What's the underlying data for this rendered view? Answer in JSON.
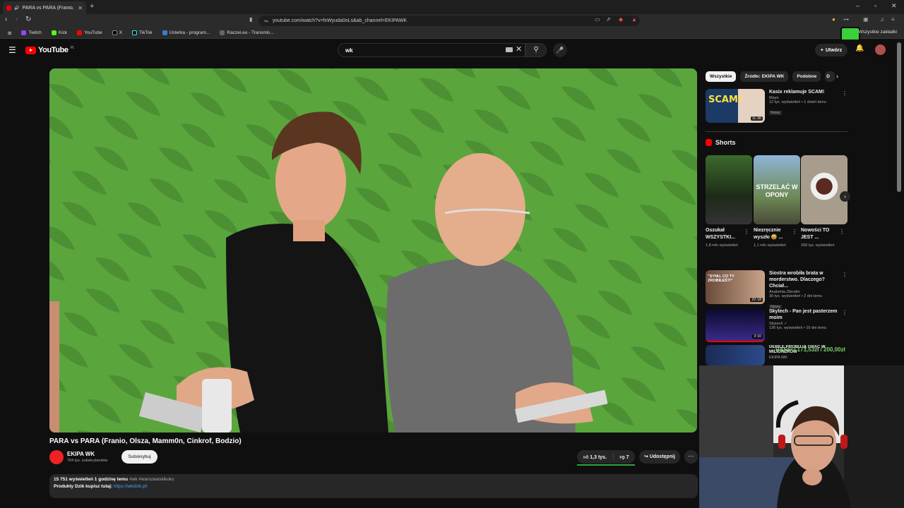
{
  "browser": {
    "tab_title": "PARA vs PARA (Franio, Olsza,",
    "url": "youtube.com/watch?v=fxWyuda0oLs&ab_channel=EKIPAWK",
    "bookmarks": [
      "Twitch",
      "Kick",
      "YouTube",
      "X",
      "TikTok",
      "Usterka - program...",
      "Raczei.eu - Transmis..."
    ],
    "all_bookmarks": "Wszystkie zakładki"
  },
  "youtube": {
    "logo": "YouTube",
    "region": "PL",
    "search_value": "wk",
    "create_label": "Utwórz"
  },
  "video": {
    "title": "PARA vs PARA (Franio, Olsza, Mamm0n, Cinkrof, Bodzio)",
    "channel": "EKIPA WK",
    "subscribers": "704 tys. subskrybentów",
    "subscribe_label": "Subskrybuj",
    "likes": "1,3 tys.",
    "dislikes": "7",
    "share_label": "Udostępnij",
    "views_time": "15 751 wyświetleń  1 godzinę temu",
    "tags": "#wk #warszawskikoks",
    "products_text": "Produkty Dzik kupisz tutaj:",
    "products_link": "https://wkdzik.pl/"
  },
  "sidebar": {
    "chips": [
      "Wszystkie",
      "Źródło: EKIPA WK",
      "Podobne",
      "D"
    ],
    "recs": [
      {
        "title": "Kasix reklamuje SCAM!",
        "channel": "Mayo",
        "meta": "12 tys. wyświetleń • 1 dzień temu",
        "badge": "Nowy",
        "duration": "11:30",
        "thumb": "SCAM!"
      },
      {
        "title": "Siostra wrobiła brata w morderstwo. Dlaczego? Chciał...",
        "channel": "Anatomia Zbrodni",
        "meta": "30 tys. wyświetleń • 2 dni temu",
        "badge": "Nowy",
        "duration": "22:18",
        "thumb": "\"SYNU, CO TY ZROBIŁEŚ?!\""
      },
      {
        "title": "Skytech - Pan jest pasterzem moim",
        "channel": "Skytech",
        "meta": "136 tys. wyświetleń • 10 dni temu",
        "badge": "",
        "duration": "3:10",
        "thumb": ""
      },
      {
        "title": "DEBILE PRÓBUJĄ GRAĆ W MILIONERÓW",
        "channel": "EKIPA WK",
        "meta": "",
        "badge": "",
        "duration": "",
        "thumb": ""
      }
    ],
    "shorts_header": "Shorts",
    "shorts": [
      {
        "title": "Oszukał WSZYSTKI...",
        "views": "1,8 mln wyświetleń",
        "thumb": ""
      },
      {
        "title": "Niezręcznie wyszło 😅 ...",
        "views": "1,1 mln wyświetleń",
        "thumb": "STRZELAĆ W OPONY"
      },
      {
        "title": "Nowości TO JEST ...",
        "views": "268 tys. wyświetleń",
        "thumb": ""
      }
    ]
  },
  "overlay": {
    "donation": "RASSO 171,53zł / 200,00zł"
  },
  "colors": {
    "accent": "#ff0000",
    "link": "#3ea6ff",
    "video_bg": "#5aa63d"
  }
}
